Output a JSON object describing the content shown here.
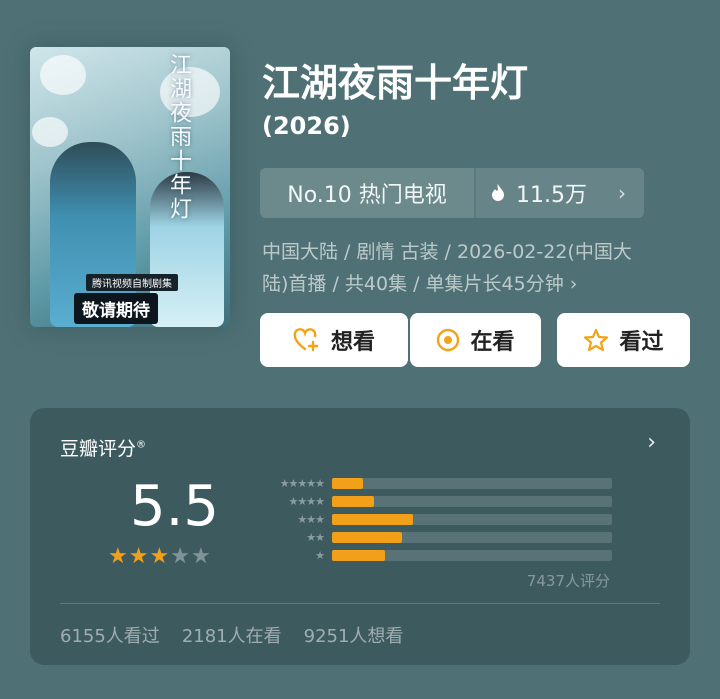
{
  "show": {
    "title": "江湖夜雨十年灯",
    "year": "(2026)",
    "rank_label": "No.10 热门电视",
    "heat_value": "11.5万",
    "meta_line1": "中国大陆 / 剧情 古装 / 2026-02-22(中国大",
    "meta_line2": "陆)首播 / 共40集 / 单集片长45分钟 ›"
  },
  "poster": {
    "calligraphy": "江湖夜雨十年灯",
    "tag_small": "腾讯视频自制剧集",
    "tag_large": "敬请期待"
  },
  "actions": {
    "want": "想看",
    "watching": "在看",
    "watched": "看过"
  },
  "rating": {
    "title": "豆瓣评分",
    "registered": "®",
    "score": "5.5",
    "stars_filled": 3,
    "stars_total": 5,
    "distribution": [
      {
        "stars": 5,
        "fraction": 0.11
      },
      {
        "stars": 4,
        "fraction": 0.15
      },
      {
        "stars": 3,
        "fraction": 0.29
      },
      {
        "stars": 2,
        "fraction": 0.25
      },
      {
        "stars": 1,
        "fraction": 0.19
      }
    ],
    "count_text": "7437人评分",
    "watched_text": "6155人看过",
    "watching_text": "2181人在看",
    "want_text": "9251人想看"
  },
  "colors": {
    "background": "#4f7175",
    "panel": "#3d5a5f",
    "accent": "#f2a019"
  }
}
